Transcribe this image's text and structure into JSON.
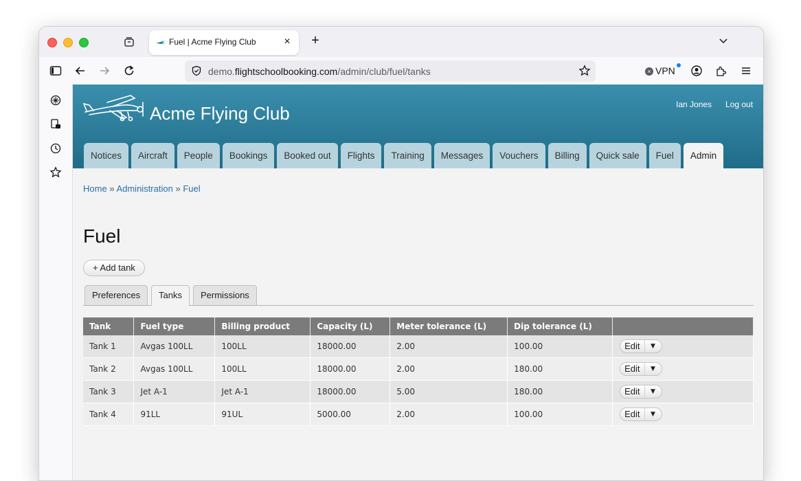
{
  "browser": {
    "tab_title": "Fuel | Acme Flying Club",
    "tab_close": "×",
    "new_tab": "+",
    "url_prefix": "demo.",
    "url_domain": "flightschoolbooking.com",
    "url_path": "/admin/club/fuel/tanks",
    "vpn_label": "VPN",
    "vpn_x": "×"
  },
  "header": {
    "club_name": "Acme Flying Club",
    "user_name": "Ian Jones",
    "logout": "Log out"
  },
  "nav": {
    "tabs": [
      "Notices",
      "Aircraft",
      "People",
      "Bookings",
      "Booked out",
      "Flights",
      "Training",
      "Messages",
      "Vouchers",
      "Billing",
      "Quick sale",
      "Fuel",
      "Admin"
    ],
    "active": "Admin"
  },
  "breadcrumb": {
    "home": "Home",
    "sep": "»",
    "admin": "Administration",
    "fuel": "Fuel"
  },
  "page": {
    "title": "Fuel",
    "add_button": "+ Add tank"
  },
  "subtabs": {
    "preferences": "Preferences",
    "tanks": "Tanks",
    "permissions": "Permissions",
    "active": "Tanks"
  },
  "table": {
    "columns": [
      "Tank",
      "Fuel type",
      "Billing product",
      "Capacity (L)",
      "Meter tolerance (L)",
      "Dip tolerance (L)",
      ""
    ],
    "rows": [
      [
        "Tank 1",
        "Avgas 100LL",
        "100LL",
        "18000.00",
        "2.00",
        "100.00"
      ],
      [
        "Tank 2",
        "Avgas 100LL",
        "100LL",
        "18000.00",
        "2.00",
        "180.00"
      ],
      [
        "Tank 3",
        "Jet A-1",
        "Jet A-1",
        "18000.00",
        "5.00",
        "180.00"
      ],
      [
        "Tank 4",
        "91LL",
        "91UL",
        "5000.00",
        "2.00",
        "100.00"
      ]
    ],
    "edit_label": "Edit",
    "caret": "▼"
  },
  "colors": {
    "header_top": "#3a8fad",
    "header_bottom": "#206c89",
    "nav_tab": "#b7d4de",
    "link": "#2a6ea6"
  }
}
